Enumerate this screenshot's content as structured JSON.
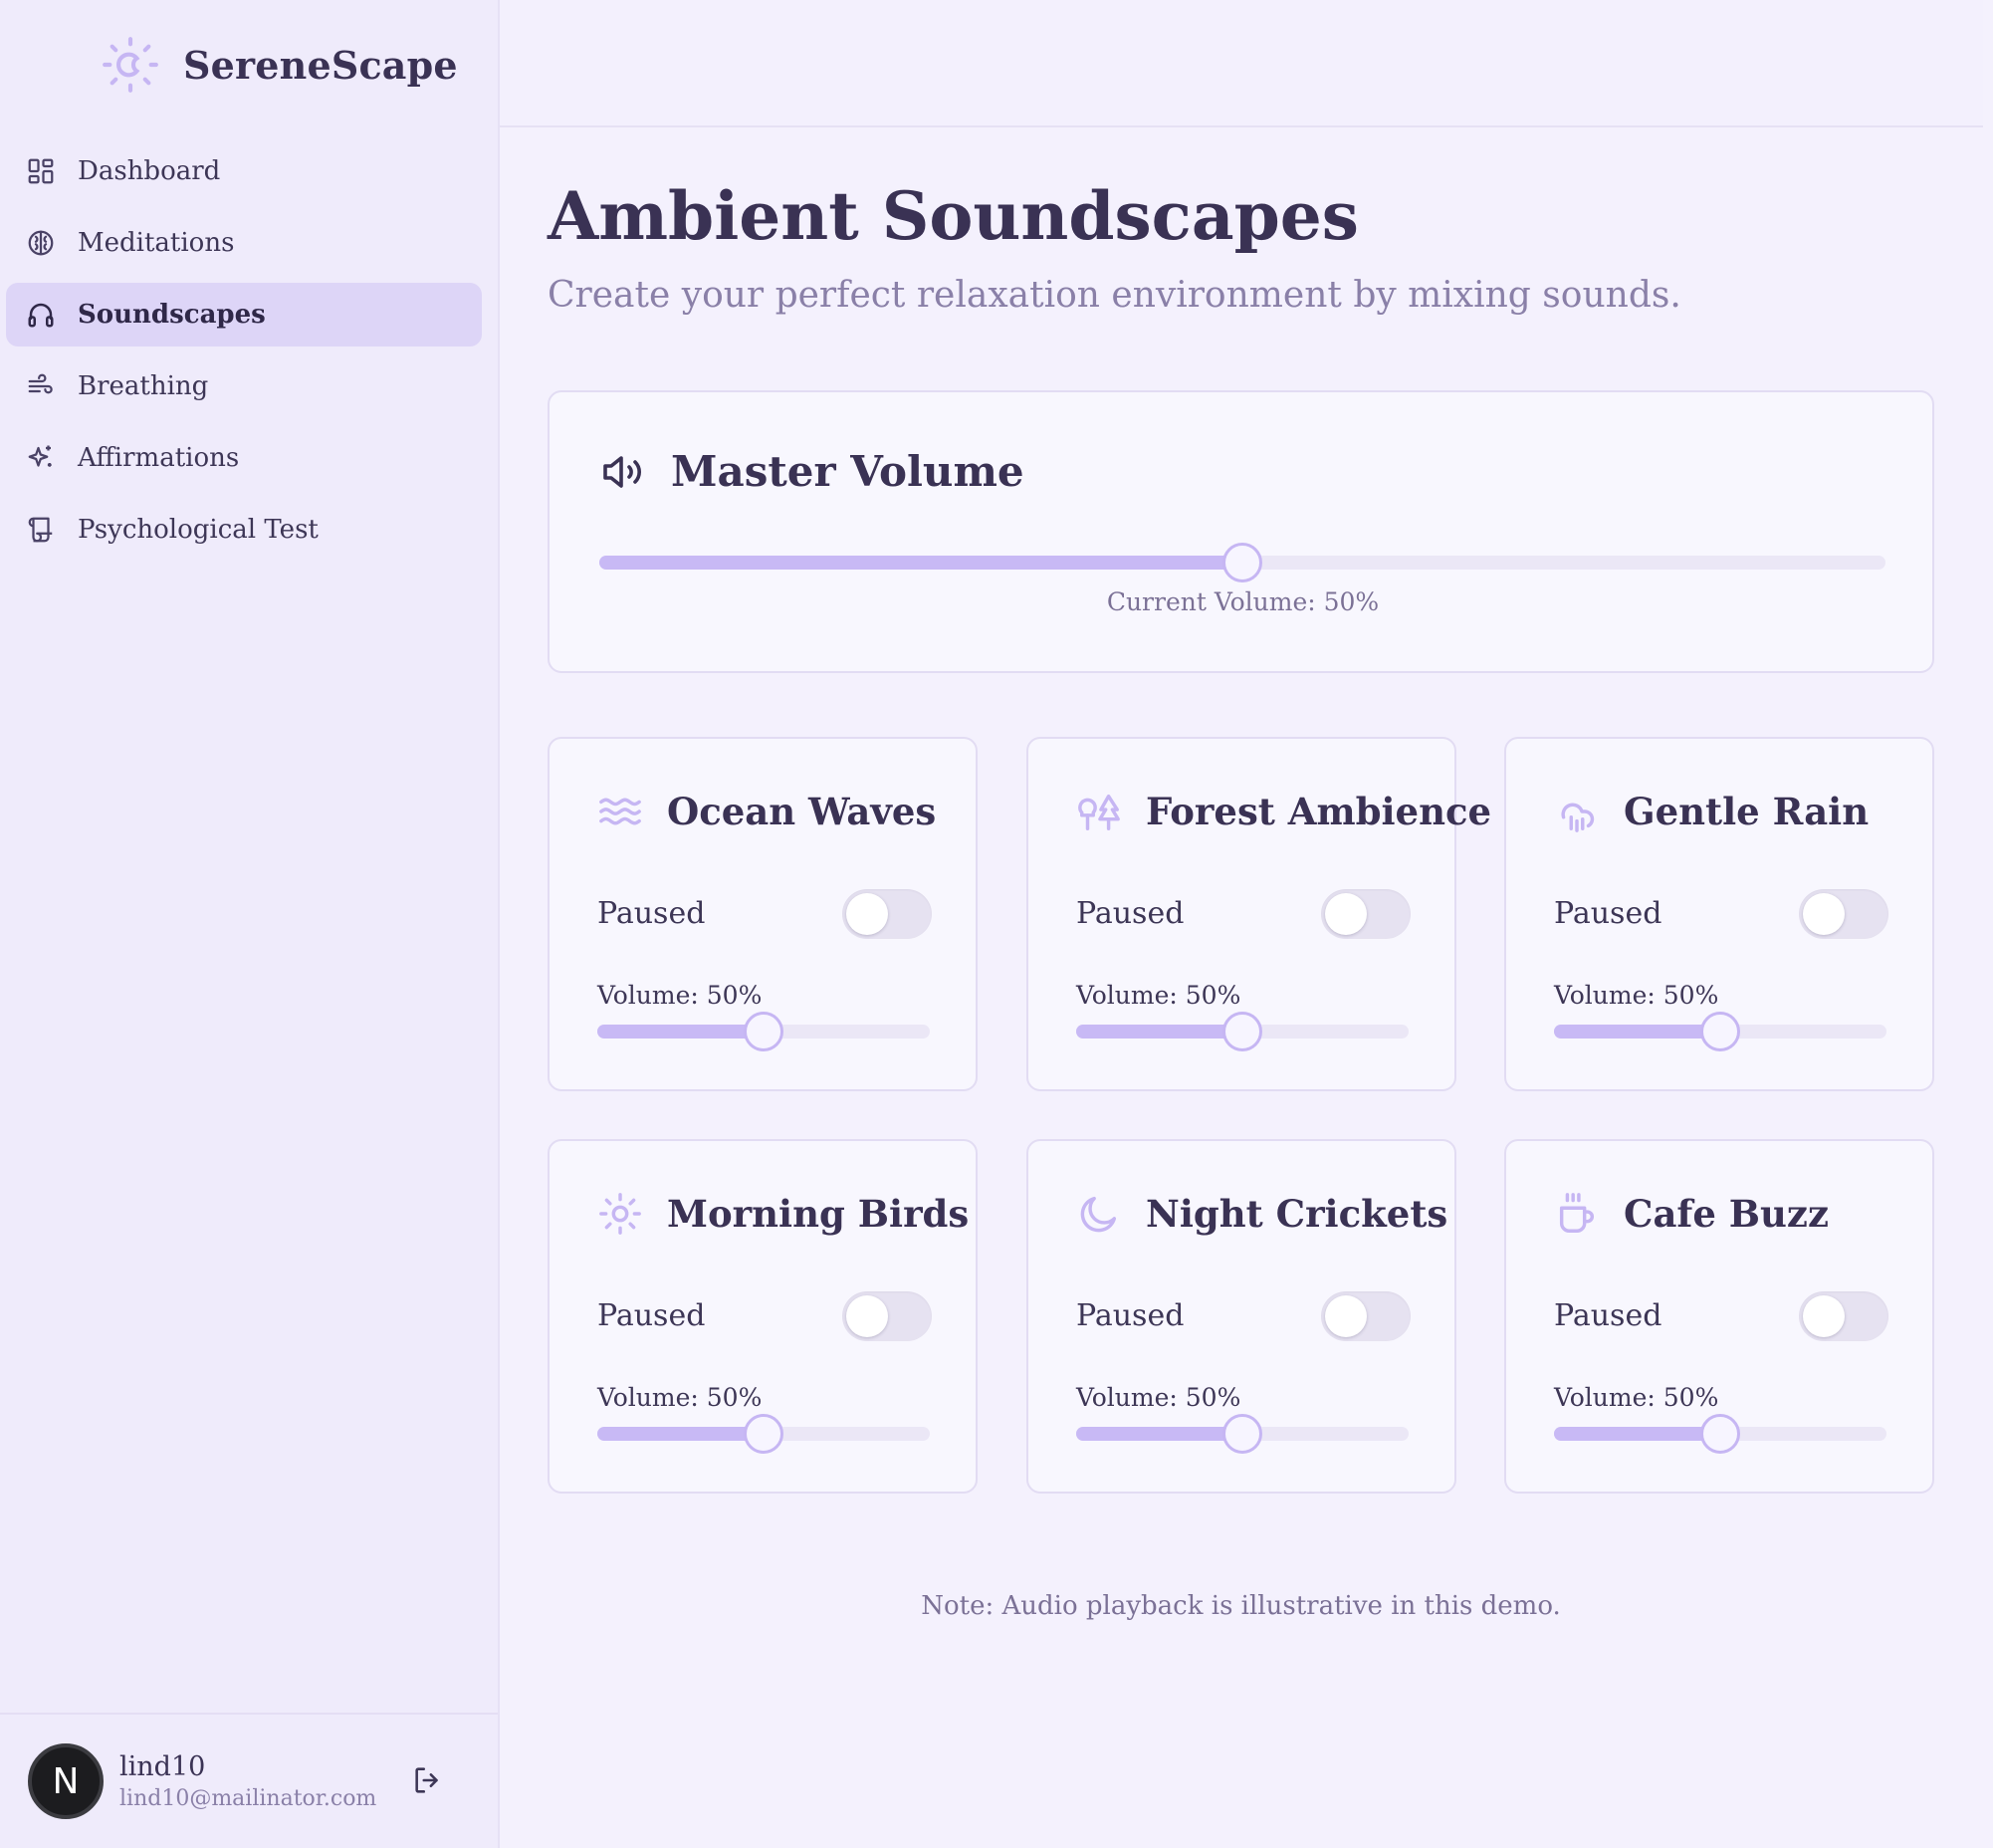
{
  "brand": {
    "name": "SereneScape",
    "icon": "sun-moon-icon",
    "accent": "#c6b6f3"
  },
  "nav": {
    "items": [
      {
        "label": "Dashboard",
        "icon": "dashboard-icon",
        "active": false
      },
      {
        "label": "Meditations",
        "icon": "brain-icon",
        "active": false
      },
      {
        "label": "Soundscapes",
        "icon": "headphones-icon",
        "active": true
      },
      {
        "label": "Breathing",
        "icon": "wind-icon",
        "active": false
      },
      {
        "label": "Affirmations",
        "icon": "sparkles-icon",
        "active": false
      },
      {
        "label": "Psychological Test",
        "icon": "scroll-icon",
        "active": false
      }
    ]
  },
  "user": {
    "initial": "N",
    "name": "lind10",
    "email": "lind10@mailinator.com"
  },
  "page": {
    "title": "Ambient Soundscapes",
    "subtitle": "Create your perfect relaxation environment by mixing sounds."
  },
  "master": {
    "title": "Master Volume",
    "icon": "volume-icon",
    "volume": 50,
    "label": "Current Volume: 50%"
  },
  "sounds": [
    {
      "title": "Ocean Waves",
      "icon": "waves-icon",
      "status": "Paused",
      "volume_label": "Volume: 50%",
      "volume": 50
    },
    {
      "title": "Forest Ambience",
      "icon": "trees-icon",
      "status": "Paused",
      "volume_label": "Volume: 50%",
      "volume": 50
    },
    {
      "title": "Gentle Rain",
      "icon": "cloud-rain-icon",
      "status": "Paused",
      "volume_label": "Volume: 50%",
      "volume": 50
    },
    {
      "title": "Morning Birds",
      "icon": "sun-icon",
      "status": "Paused",
      "volume_label": "Volume: 50%",
      "volume": 50
    },
    {
      "title": "Night Crickets",
      "icon": "moon-icon",
      "status": "Paused",
      "volume_label": "Volume: 50%",
      "volume": 50
    },
    {
      "title": "Cafe Buzz",
      "icon": "coffee-icon",
      "status": "Paused",
      "volume_label": "Volume: 50%",
      "volume": 50
    }
  ],
  "note": "Note: Audio playback is illustrative in this demo.",
  "colors": {
    "sidebar_bg": "#efebfb",
    "active_nav": "#ddd5f7",
    "slider_fill": "#c8b9f5",
    "text": "#3a3254",
    "muted": "#8a80a8"
  }
}
